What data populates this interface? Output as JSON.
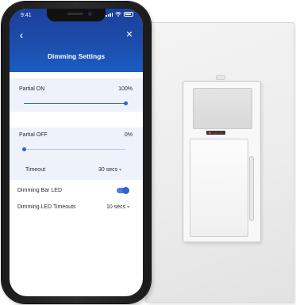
{
  "status_bar": {
    "time": "9:41"
  },
  "header": {
    "title": "Dimming Settings",
    "back_glyph": "‹",
    "close_glyph": "✕"
  },
  "settings": {
    "partial_on": {
      "label": "Partial ON",
      "value": "100%",
      "level_percent": 100
    },
    "partial_off": {
      "label": "Partial OFF",
      "value": "0%",
      "level_percent": 0
    },
    "timeout": {
      "label": "Timeout",
      "value": "30 secs"
    },
    "dimming_bar_led": {
      "label": "Dimming Bar LED",
      "enabled": true
    },
    "dimming_led_timeouts": {
      "label": "Dimming LED Timeouts",
      "value": "10 secs"
    }
  },
  "icons": {
    "back": "chevron-left-icon",
    "close": "close-icon",
    "dropdown": "chevron-down-icon",
    "signal": "cellular-signal-icon",
    "wifi": "wifi-icon",
    "battery": "battery-icon"
  },
  "colors": {
    "header_top": "#1b3f9e",
    "header_bottom": "#1a5dc0",
    "accent": "#2e63d0",
    "section_bg": "#eef2fb"
  }
}
